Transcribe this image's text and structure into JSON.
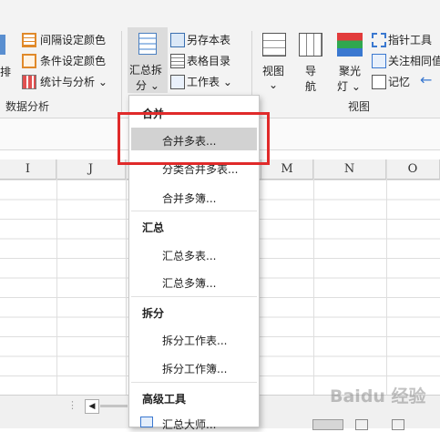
{
  "ribbon": {
    "left_partial": {
      "label_1": "排",
      "item_interval_color": "间隔设定颜色",
      "item_condition_color": "条件设定颜色",
      "item_stats_analysis": "统计与分析 ⌄",
      "group_label": "数据分析"
    },
    "summary_split": {
      "button_line1": "汇总拆",
      "button_line2": "分 ⌄",
      "item_save_as": "另存本表",
      "item_sheet_dir": "表格目录",
      "item_worksheet": "工作表 ⌄"
    },
    "view": {
      "view_button": "视图",
      "view_button_sub": "⌄",
      "nav_button": "导",
      "nav_button_sub": "航",
      "spotlight_button": "聚光",
      "spotlight_button_sub": "灯 ⌄",
      "item_pointer": "指针工具",
      "item_focus": "关注相同值",
      "item_memory": "记忆",
      "group_label": "视图"
    }
  },
  "columns": [
    "I",
    "J",
    "M",
    "N",
    "O"
  ],
  "dropdown": {
    "section_merge": "合并",
    "item_merge_sheets": "合并多表...",
    "item_classify_merge": "分类合并多表...",
    "item_merge_workbooks": "合并多簿...",
    "section_summary": "汇总",
    "item_summary_sheets": "汇总多表...",
    "item_summary_workbooks": "汇总多簿...",
    "section_split": "拆分",
    "item_split_sheet": "拆分工作表...",
    "item_split_workbook": "拆分工作簿...",
    "section_advanced": "高级工具",
    "item_summary_master": "汇总大师..."
  },
  "watermark": "Baidu 经验",
  "colors": {
    "highlight": "#d2d2d2",
    "annotation_red": "#e02a2a",
    "ribbon_bg": "#f3f3f3"
  }
}
